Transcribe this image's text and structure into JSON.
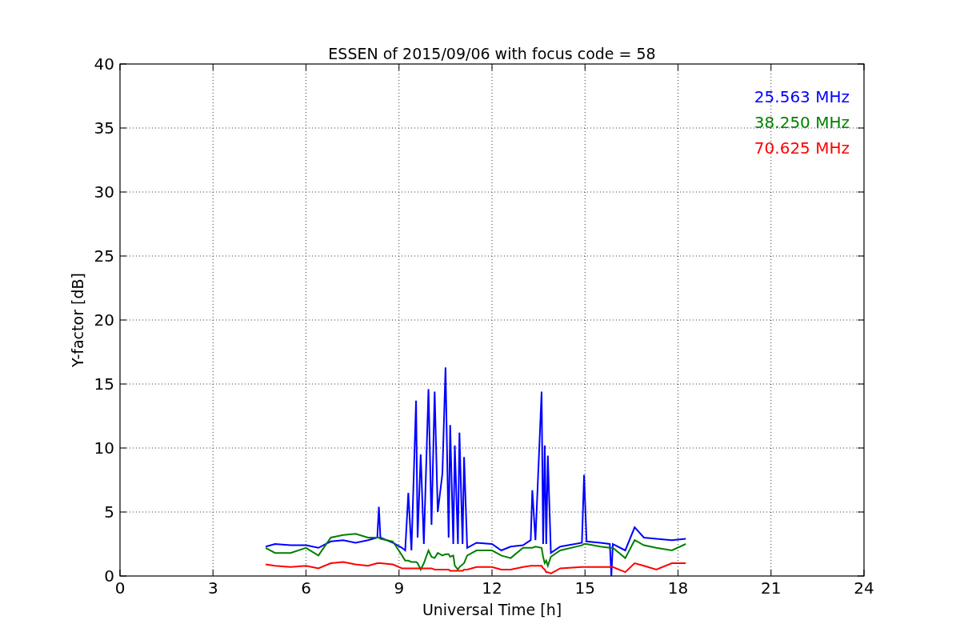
{
  "chart": {
    "chart_data": {
      "type": "line",
      "title": "ESSEN of 2015/09/06 with focus code = 58",
      "xlabel": "Universal Time [h]",
      "ylabel": "Y-factor [dB]",
      "x": [
        4.7,
        5.0,
        5.5,
        6.0,
        6.4,
        6.8,
        7.2,
        7.6,
        8.0,
        8.3,
        8.35,
        8.4,
        8.8,
        9.1,
        9.2,
        9.3,
        9.4,
        9.55,
        9.6,
        9.7,
        9.8,
        9.95,
        10.05,
        10.15,
        10.25,
        10.4,
        10.5,
        10.6,
        10.65,
        10.75,
        10.8,
        10.9,
        10.95,
        11.05,
        11.1,
        11.2,
        11.5,
        12.0,
        12.3,
        12.6,
        13.0,
        13.25,
        13.3,
        13.4,
        13.6,
        13.65,
        13.7,
        13.75,
        13.8,
        13.9,
        14.2,
        14.9,
        14.97,
        15.05,
        15.5,
        15.8,
        15.85,
        15.9,
        16.3,
        16.6,
        16.9,
        17.3,
        17.8,
        18.25
      ],
      "series": [
        {
          "name": "25.563 MHz",
          "color": "#0000ff",
          "values": [
            2.3,
            2.5,
            2.4,
            2.4,
            2.2,
            2.7,
            2.8,
            2.6,
            2.8,
            3.0,
            5.4,
            3.0,
            2.6,
            2.2,
            2.0,
            6.5,
            2.0,
            13.7,
            3.0,
            9.5,
            2.5,
            14.6,
            4.0,
            14.4,
            5.0,
            8.0,
            16.3,
            3.0,
            11.8,
            2.5,
            10.2,
            2.5,
            11.2,
            2.5,
            9.3,
            2.2,
            2.6,
            2.5,
            2.0,
            2.3,
            2.4,
            2.8,
            6.7,
            2.8,
            14.4,
            2.5,
            10.2,
            2.5,
            9.4,
            1.8,
            2.3,
            2.6,
            7.9,
            2.7,
            2.6,
            2.5,
            0,
            2.5,
            2.0,
            3.8,
            3.0,
            2.9,
            2.8,
            2.9
          ]
        },
        {
          "name": "38.250 MHz",
          "color": "#008000",
          "values": [
            2.2,
            1.8,
            1.8,
            2.2,
            1.6,
            3.0,
            3.2,
            3.3,
            3.0,
            3.0,
            3.0,
            2.9,
            2.7,
            1.6,
            1.2,
            1.2,
            1.1,
            1.1,
            1.0,
            0.5,
            1.0,
            2.0,
            1.5,
            1.4,
            1.8,
            1.6,
            1.7,
            1.7,
            1.5,
            1.6,
            0.8,
            0.5,
            0.7,
            0.9,
            1.0,
            1.6,
            2.0,
            2.0,
            1.6,
            1.4,
            2.2,
            2.2,
            2.2,
            2.3,
            2.2,
            1.5,
            1.0,
            1.2,
            0.8,
            1.5,
            2.0,
            2.4,
            2.5,
            2.5,
            2.3,
            2.2,
            2.2,
            2.2,
            1.4,
            2.8,
            2.4,
            2.2,
            2.0,
            2.5
          ]
        },
        {
          "name": "70.625 MHz",
          "color": "#ff0000",
          "values": [
            0.9,
            0.8,
            0.7,
            0.8,
            0.6,
            1.0,
            1.1,
            0.9,
            0.8,
            1.0,
            1.0,
            1.0,
            0.9,
            0.6,
            0.6,
            0.6,
            0.6,
            0.6,
            0.6,
            0.6,
            0.6,
            0.6,
            0.6,
            0.5,
            0.5,
            0.5,
            0.5,
            0.5,
            0.4,
            0.4,
            0.4,
            0.4,
            0.4,
            0.4,
            0.5,
            0.5,
            0.7,
            0.7,
            0.5,
            0.5,
            0.7,
            0.8,
            0.8,
            0.8,
            0.8,
            0.6,
            0.5,
            0.3,
            0.3,
            0.2,
            0.6,
            0.7,
            0.7,
            0.7,
            0.7,
            0.7,
            0.7,
            0.7,
            0.3,
            1.0,
            0.8,
            0.5,
            1.0,
            1.0
          ]
        }
      ],
      "grid": true,
      "xlim": [
        0,
        24
      ],
      "ylim": [
        0,
        40
      ],
      "xticks": [
        0,
        3,
        6,
        9,
        12,
        15,
        18,
        21,
        24
      ],
      "yticks": [
        0,
        5,
        10,
        15,
        20,
        25,
        30,
        35,
        40
      ]
    }
  }
}
